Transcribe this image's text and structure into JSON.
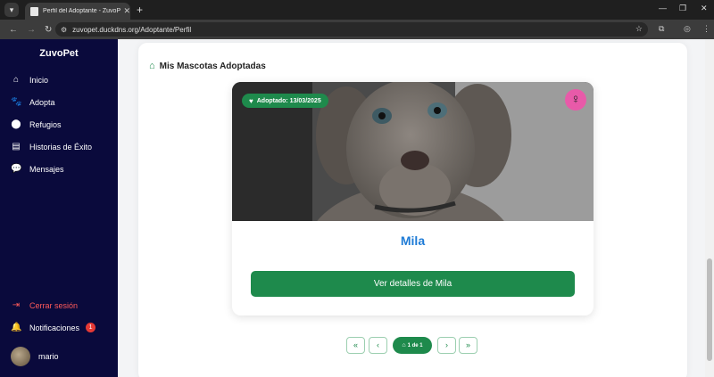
{
  "browser": {
    "tab_title": "Perfil del Adoptante - ZuvoPet",
    "url": "zuvopet.duckdns.org/Adoptante/Perfil"
  },
  "sidebar": {
    "brand": "ZuvoPet",
    "items": [
      {
        "label": "Inicio",
        "icon": "home-icon"
      },
      {
        "label": "Adopta",
        "icon": "paw-icon"
      },
      {
        "label": "Refugios",
        "icon": "map-pin-icon"
      },
      {
        "label": "Historias de Éxito",
        "icon": "book-icon"
      },
      {
        "label": "Mensajes",
        "icon": "chat-icon"
      }
    ],
    "logout": "Cerrar sesión",
    "notifications": "Notificaciones",
    "notifications_count": "1",
    "user_name": "mario"
  },
  "main": {
    "section_title": "Mis Mascotas Adoptadas",
    "pet": {
      "adopted_label": "Adoptado: 13/03/2025",
      "gender_symbol": "♀",
      "name": "Mila",
      "details_button": "Ver detalles de Mila"
    },
    "pagination": {
      "first": "«",
      "prev": "‹",
      "current": "1 de 1",
      "next": "›",
      "last": "»"
    }
  },
  "colors": {
    "sidebar_bg": "#0a0a3c",
    "primary_green": "#1e8a4c",
    "pet_name_blue": "#1e7bd6",
    "gender_pink": "#e85aa9",
    "logout_red": "#ff5a5a"
  }
}
